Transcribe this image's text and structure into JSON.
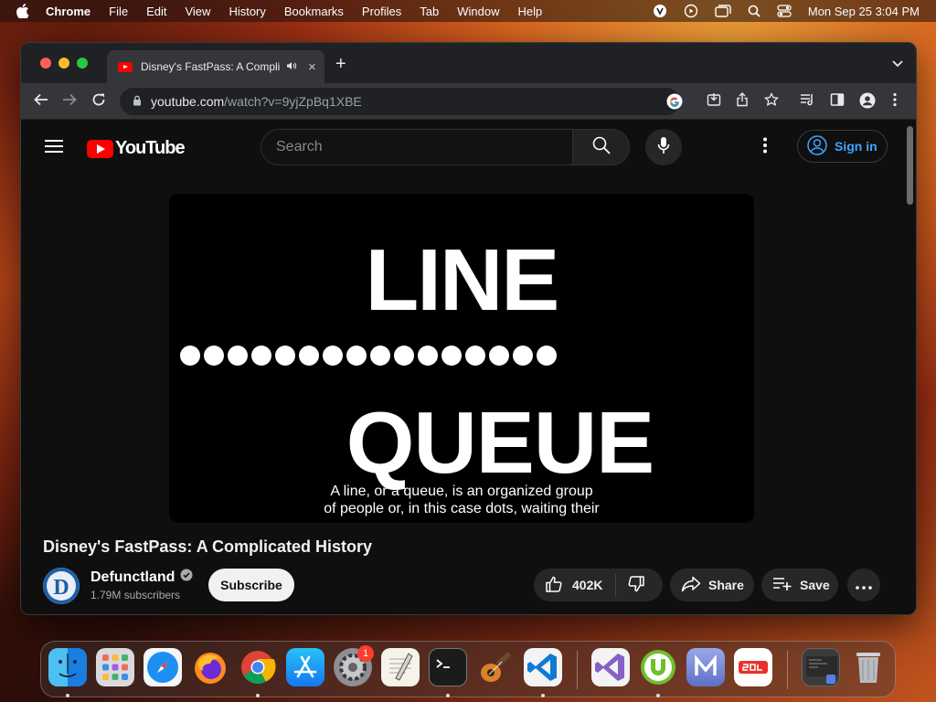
{
  "menubar": {
    "app": "Chrome",
    "items": [
      "File",
      "Edit",
      "View",
      "History",
      "Bookmarks",
      "Profiles",
      "Tab",
      "Window",
      "Help"
    ],
    "clock": "Mon Sep 25  3:04 PM"
  },
  "browser": {
    "tab_title": "Disney's FastPass: A Complicated History",
    "url_host": "youtube.com",
    "url_path": "/watch?v=9yjZpBq1XBE"
  },
  "youtube": {
    "logo_text": "YouTube",
    "search_placeholder": "Search",
    "sign_in": "Sign in",
    "player": {
      "word_top": "LINE",
      "word_bottom": "QUEUE",
      "dot_count": 16,
      "caption_line1": "A line, or a queue, is an organized group",
      "caption_line2": "of people or, in this case dots, waiting their"
    },
    "video_title": "Disney's FastPass: A Complicated History",
    "channel_initial": "D",
    "channel_name": "Defunctland",
    "subscribers": "1.79M subscribers",
    "subscribe_label": "Subscribe",
    "like_count": "402K",
    "share_label": "Share",
    "save_label": "Save"
  },
  "dock": {
    "badge_settings": "1",
    "apps": [
      "Finder",
      "Launchpad",
      "Safari",
      "Firefox",
      "Chrome",
      "App Store",
      "System Settings",
      "TextEdit",
      "Terminal",
      "GarageBand",
      "Visual Studio Code",
      "Visual Studio",
      "uTorrent",
      "Mail",
      "SQL",
      "Preview",
      "Trash"
    ]
  },
  "colors": {
    "youtube_red": "#ff0000",
    "link_blue": "#3ea6ff",
    "page_bg": "#0f0f0f"
  }
}
